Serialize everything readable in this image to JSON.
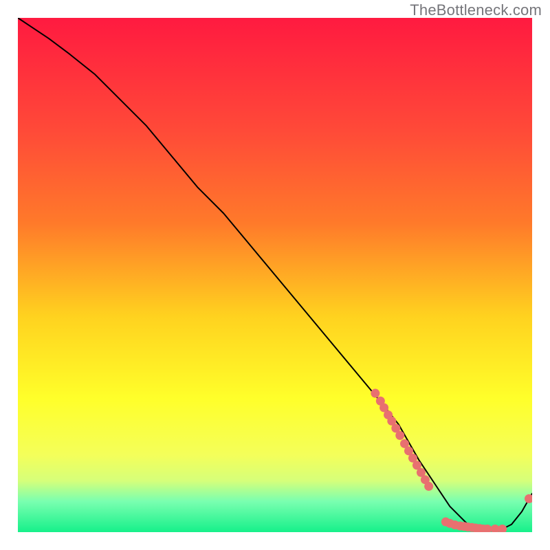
{
  "watermark": "TheBottleneck.com",
  "colors": {
    "gradient_top": "#ff1a40",
    "gradient_mid1": "#ff7a2a",
    "gradient_mid2": "#ffd21f",
    "gradient_mid3": "#ffff2a",
    "gradient_green1": "#d6ff7a",
    "gradient_green2": "#7affb0",
    "gradient_bottom": "#16f08a",
    "curve": "#000000",
    "dot_fill": "#e87070",
    "dot_stroke": "#c84f4f"
  },
  "chart_data": {
    "type": "line",
    "title": "",
    "xlabel": "",
    "ylabel": "",
    "xlim": [
      0,
      100
    ],
    "ylim": [
      0,
      100
    ],
    "series": [
      {
        "name": "bottleneck-curve",
        "x": [
          0,
          6,
          10,
          15,
          20,
          25,
          30,
          35,
          40,
          45,
          50,
          55,
          60,
          65,
          70,
          74,
          78,
          80,
          82,
          84,
          86,
          88,
          90,
          92,
          94,
          96,
          98,
          100
        ],
        "y": [
          100,
          96,
          93,
          89,
          84,
          79,
          73,
          67,
          62,
          56,
          50,
          44,
          38,
          32,
          26,
          21,
          14,
          11,
          8,
          5,
          3,
          1,
          0.5,
          0.5,
          0.5,
          1.5,
          4.0,
          7.5
        ]
      }
    ],
    "dot_clusters": [
      {
        "name": "upper-slope-cluster",
        "points": [
          [
            69.5,
            27.0
          ],
          [
            70.5,
            25.5
          ],
          [
            71.2,
            24.2
          ],
          [
            72.0,
            22.8
          ],
          [
            72.7,
            21.6
          ],
          [
            73.5,
            20.2
          ],
          [
            74.3,
            18.8
          ],
          [
            75.2,
            17.2
          ],
          [
            76.0,
            15.8
          ],
          [
            76.8,
            14.4
          ],
          [
            77.6,
            13.0
          ],
          [
            78.4,
            11.6
          ],
          [
            79.2,
            10.2
          ],
          [
            79.9,
            8.9
          ]
        ]
      },
      {
        "name": "bottom-flat-cluster",
        "points": [
          [
            83.2,
            2.0
          ],
          [
            84.0,
            1.7
          ],
          [
            85.0,
            1.4
          ],
          [
            86.0,
            1.2
          ],
          [
            86.8,
            1.1
          ],
          [
            87.5,
            1.0
          ],
          [
            88.3,
            0.9
          ],
          [
            89.0,
            0.8
          ],
          [
            89.8,
            0.7
          ],
          [
            90.5,
            0.6
          ],
          [
            91.3,
            0.6
          ],
          [
            92.8,
            0.6
          ],
          [
            94.2,
            0.6
          ]
        ]
      },
      {
        "name": "upturn-dot",
        "points": [
          [
            99.4,
            6.5
          ]
        ]
      }
    ]
  }
}
